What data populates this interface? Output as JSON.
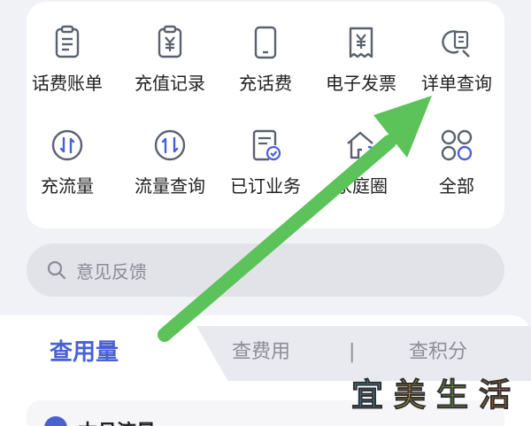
{
  "grid": {
    "items": [
      {
        "label": "话费账单",
        "icon": "bill-icon"
      },
      {
        "label": "充值记录",
        "icon": "recharge-record-icon"
      },
      {
        "label": "充话费",
        "icon": "phone-icon"
      },
      {
        "label": "电子发票",
        "icon": "invoice-icon"
      },
      {
        "label": "详单查询",
        "icon": "detail-search-icon"
      },
      {
        "label": "充流量",
        "icon": "data-recharge-icon"
      },
      {
        "label": "流量查询",
        "icon": "data-query-icon"
      },
      {
        "label": "已订业务",
        "icon": "subscribed-icon"
      },
      {
        "label": "家庭圈",
        "icon": "home-circle-icon"
      },
      {
        "label": "全部",
        "icon": "all-apps-icon"
      }
    ]
  },
  "search": {
    "placeholder": "意见反馈",
    "icon": "search-icon"
  },
  "tabs": {
    "active": "查用量",
    "fee": "查费用",
    "divider": "|",
    "points": "查积分"
  },
  "list": {
    "first_title": "本月流量"
  },
  "annotation": {
    "arrow_color": "#5cc35a"
  },
  "watermark": {
    "chars": [
      "宜",
      "美",
      "生",
      "活"
    ],
    "colors": [
      "#39a8e0",
      "#f2c81c",
      "#7cc242",
      "#f08a24"
    ]
  },
  "colors": {
    "accent": "#4a61d4",
    "icon_stroke": "#5a6270",
    "icon_accent": "#4a61d4"
  }
}
